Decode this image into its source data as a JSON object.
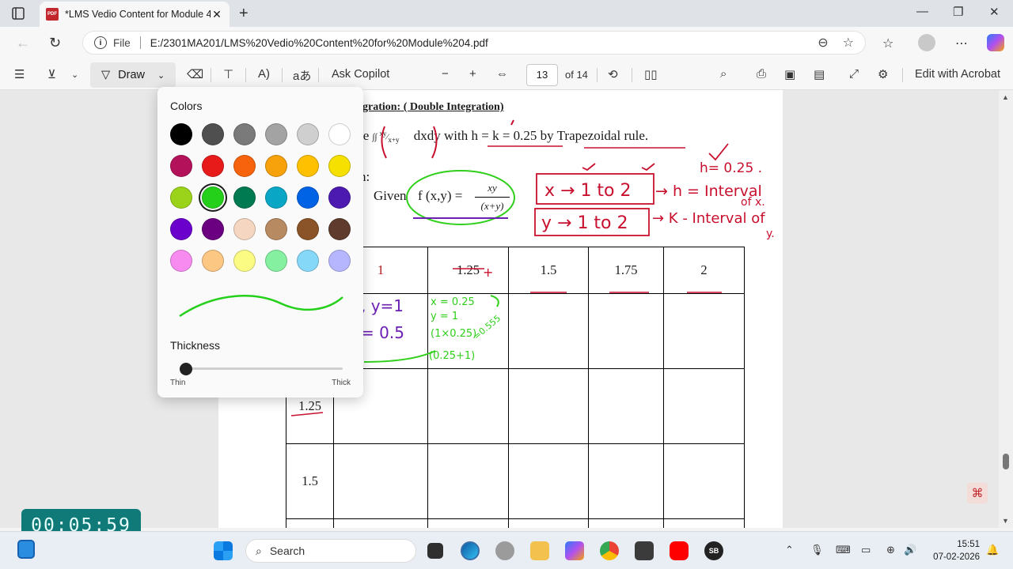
{
  "browser": {
    "tab_title": "*LMS Vedio Content for Module 4",
    "pdf_badge": "PDF",
    "file_label": "File",
    "url": "E:/2301MA201/LMS%20Vedio%20Content%20for%20Module%204.pdf"
  },
  "pdf_toolbar": {
    "draw_label": "Draw",
    "ask_copilot": "Ask Copilot",
    "page_number": "13",
    "page_total": "of 14",
    "edit_acrobat": "Edit with Acrobat"
  },
  "draw_flyout": {
    "colors_label": "Colors",
    "colors": [
      "#000000",
      "#4f4f4f",
      "#7a7a7a",
      "#a3a3a3",
      "#cfcfcf",
      "#ffffff",
      "#b3125a",
      "#e81b1b",
      "#f7630c",
      "#f7a10b",
      "#ffc000",
      "#f5e000",
      "#9bd21a",
      "#24d01a",
      "#007a50",
      "#0aa6c6",
      "#0063e6",
      "#4c1ab0",
      "#6b00cc",
      "#6b0080",
      "#f4d6c1",
      "#b88a62",
      "#8a5428",
      "#5e3b2c",
      "#f78bf0",
      "#fcc683",
      "#fbfb84",
      "#84f0a0",
      "#86d8f8",
      "#b6b6ff"
    ],
    "selected_index": 13,
    "pen_color": "#24d01a",
    "thickness_label": "Thickness",
    "thin_label": "Thin",
    "thick_label": "Thick",
    "thickness_value": 0.0
  },
  "document": {
    "heading": "gration:  ( Double Integration)",
    "problem_lead": "te",
    "problem_tail": "dxdy with h = k = 0.25 by Trapezoidal rule.",
    "solution_fragment": "n:",
    "given_label": "Given",
    "given_f": "f (x,y) =",
    "frac_num": "xy",
    "frac_den": "(x+y)",
    "table_header": [
      "",
      "1",
      "1.25",
      "1.5",
      "1.75",
      "2"
    ],
    "row_labels": [
      "",
      "1.25",
      "1.5"
    ],
    "annotations": {
      "h_value": "h= 0.25 .",
      "x_range": "x → 1 to 2",
      "y_range": "y → 1 to 2",
      "h_interval": "→ h = Interval",
      "of_x": "of x.",
      "k_interval": "→ K - Interval of",
      "of_y": "y.",
      "cell_purple_1": ", y=1",
      "cell_purple_2": "= 0.5",
      "cell_green_1": "x = 0.25",
      "cell_green_2": "y = 1",
      "cell_green_3": "(1×0.25)",
      "cell_green_4": "(0.25+1)",
      "cell_green_5": "=0.555"
    }
  },
  "timer": "00:05:59",
  "taskbar": {
    "search_placeholder": "Search",
    "time": "15:51",
    "date": "07-02-2026"
  }
}
